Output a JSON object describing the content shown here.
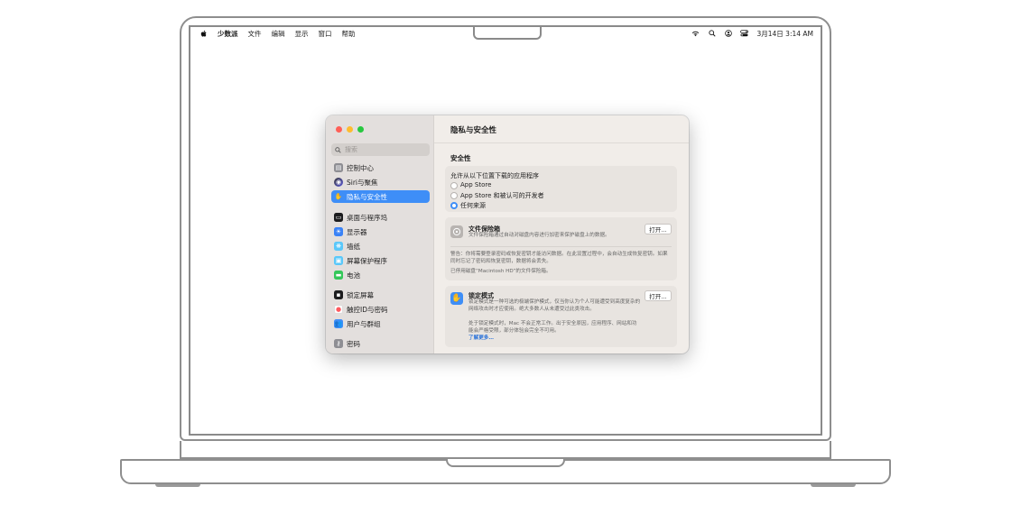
{
  "menubar": {
    "apple_icon": "apple-icon",
    "app_name": "少数派",
    "menus": [
      "文件",
      "编辑",
      "显示",
      "窗口",
      "帮助"
    ],
    "status_icons": [
      "wifi-icon",
      "search-icon",
      "user-icon",
      "control-center-icon"
    ],
    "datetime": "3月14日  3:14 AM"
  },
  "window": {
    "title": "隐私与安全性",
    "traffic_light_colors": [
      "#ff5f57",
      "#febc2e",
      "#28c840"
    ],
    "search_placeholder": "搜索",
    "sidebar": [
      {
        "label": "控制中心",
        "icon": "control-center-icon",
        "color": "#8e8e93"
      },
      {
        "label": "Siri与聚焦",
        "icon": "siri-icon",
        "color": "#2c2c2e"
      },
      {
        "label": "隐私与安全性",
        "icon": "hand-icon",
        "color": "#3e8ef7",
        "active": true
      },
      {
        "label": "桌面与程序坞",
        "icon": "desktop-icon",
        "color": "#1c1c1e"
      },
      {
        "label": "显示器",
        "icon": "display-icon",
        "color": "#3a82f6"
      },
      {
        "label": "墙纸",
        "icon": "wallpaper-icon",
        "color": "#5ac8fa"
      },
      {
        "label": "屏幕保护程序",
        "icon": "screensaver-icon",
        "color": "#5ac8fa"
      },
      {
        "label": "电池",
        "icon": "battery-icon",
        "color": "#34c759"
      },
      {
        "label": "锁定屏幕",
        "icon": "lock-icon",
        "color": "#1c1c1e"
      },
      {
        "label": "触控ID与密码",
        "icon": "fingerprint-icon",
        "color": "#ff6b6b"
      },
      {
        "label": "用户与群组",
        "icon": "users-icon",
        "color": "#3e8ef7"
      },
      {
        "label": "密码",
        "icon": "key-icon",
        "color": "#8e8e93"
      }
    ],
    "section_title": "安全性",
    "downloads": {
      "heading": "允许从以下位置下载的应用程序",
      "options": [
        {
          "label": "App Store",
          "selected": false
        },
        {
          "label": "App Store 和被认可的开发者",
          "selected": false
        },
        {
          "label": "任何来源",
          "selected": true
        }
      ]
    },
    "filevault": {
      "title": "文件保险箱",
      "description": "文件保险箱通过自动对磁盘内容进行加密来保护磁盘上的数据。",
      "button": "打开…",
      "warning": "警告：你将需要登录密码或恢复密钥才能访问数据。在此设置过程中，会自动生成恢复密钥。如果同时忘记了密码和恢复密钥，数据将会丢失。",
      "status": "已停用磁盘“Macintosh HD”的文件保险箱。"
    },
    "lockdown": {
      "title": "锁定模式",
      "description": "锁定模式是一种可选的极端保护模式，仅当你认为个人可能遭受到高度复杂的网络攻击时才应使用。绝大多数人从未遭受过此类攻击。",
      "button": "打开…",
      "detail": "处于锁定模式时，Mac 不会正常工作。出于安全原因，应用程序、网站和功能会严格受限，部分体验会完全不可用。",
      "link": "了解更多…"
    }
  }
}
